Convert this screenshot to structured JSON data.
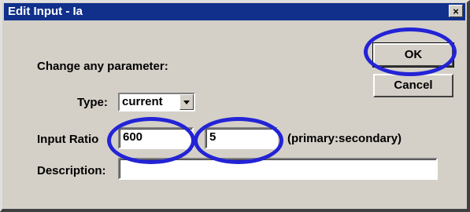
{
  "dialog": {
    "title": "Edit Input - Ia",
    "close_label": "×",
    "prompt": "Change any parameter:",
    "ok_label": "OK",
    "cancel_label": "Cancel"
  },
  "type_field": {
    "label": "Type:",
    "selected": "current"
  },
  "ratio": {
    "label": "Input Ratio",
    "primary_value": "600",
    "secondary_value": "5",
    "hint": "(primary:secondary)"
  },
  "description": {
    "label": "Description:",
    "value": ""
  },
  "colors": {
    "titlebar": "#10308c",
    "dialog_face": "#d4d0c8",
    "highlight_ring": "#2323d6"
  },
  "icons": {
    "close": "close-icon",
    "dropdown": "chevron-down-icon"
  }
}
